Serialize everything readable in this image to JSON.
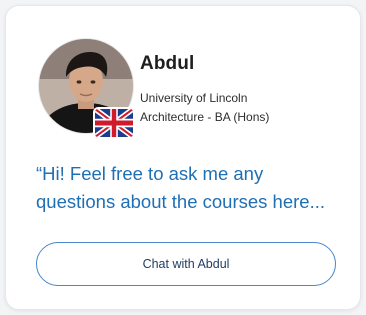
{
  "profile": {
    "name": "Abdul",
    "university": "University of Lincoln",
    "course": "Architecture - BA (Hons)",
    "avatar": "profile-photo",
    "flag": "uk-flag-icon"
  },
  "message": {
    "line1": "“Hi! Feel free to ask me any",
    "line2": "questions about the courses here..."
  },
  "actions": {
    "chat_label": "Chat with Abdul"
  },
  "colors": {
    "accent_blue": "#1f6fb5",
    "button_border": "#4a86c9",
    "name_text": "#1f1f1f"
  }
}
